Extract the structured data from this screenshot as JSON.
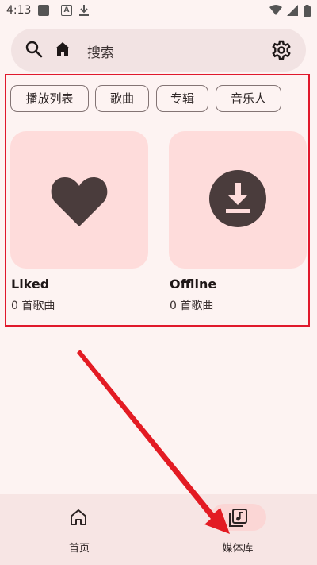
{
  "status_bar": {
    "time": "4:13"
  },
  "search": {
    "placeholder": "搜索"
  },
  "chips": [
    {
      "label": "播放列表"
    },
    {
      "label": "歌曲"
    },
    {
      "label": "专辑"
    },
    {
      "label": "音乐人"
    }
  ],
  "cards": [
    {
      "title": "Liked",
      "subtitle": "0 首歌曲",
      "icon": "heart-icon"
    },
    {
      "title": "Offline",
      "subtitle": "0 首歌曲",
      "icon": "download-icon"
    }
  ],
  "bottom_nav": [
    {
      "label": "首页",
      "icon": "home-icon",
      "selected": false
    },
    {
      "label": "媒体库",
      "icon": "library-music-icon",
      "selected": true
    }
  ],
  "colors": {
    "background": "#fdf3f2",
    "card": "#fedcdb",
    "icon_dark": "#4a3c3c",
    "highlight": "#e0182c",
    "nav_selected": "#fbd6d5"
  }
}
